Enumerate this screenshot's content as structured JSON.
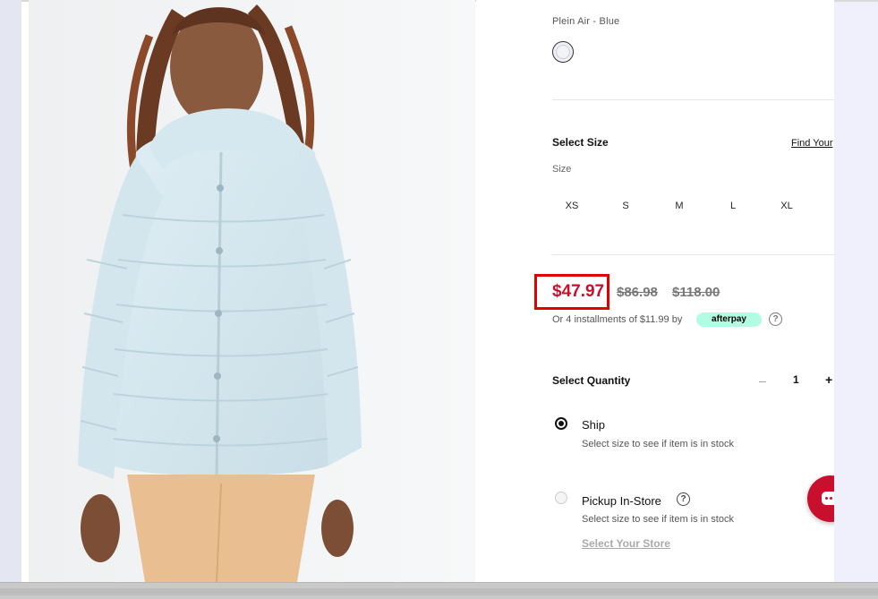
{
  "product": {
    "color_name": "Plein Air - Blue",
    "select_size_heading": "Select Size",
    "find_size_link": "Find Your",
    "size_label": "Size",
    "sizes": [
      "XS",
      "S",
      "M",
      "L",
      "XL"
    ],
    "price_sale": "$47.97",
    "price_previous": "$86.98",
    "price_original": "$118.00",
    "installments_text": "Or 4 installments of $11.99 by",
    "afterpay_label": "afterpay",
    "help_glyph": "?",
    "quantity_heading": "Select Quantity",
    "quantity_minus": "–",
    "quantity_value": "1",
    "quantity_plus": "+",
    "ship_label": "Ship",
    "ship_sub": "Select size to see if item is in stock",
    "pickup_label": "Pickup In-Store",
    "pickup_sub": "Select size to see if item is in stock",
    "store_link": "Select Your Store"
  },
  "colors": {
    "sale_red": "#c8102e",
    "highlight_box": "#e00000",
    "afterpay_mint": "#b2fce4"
  },
  "icons": [
    "help-icon",
    "chat-icon",
    "radio-selected",
    "radio-unselected"
  ]
}
